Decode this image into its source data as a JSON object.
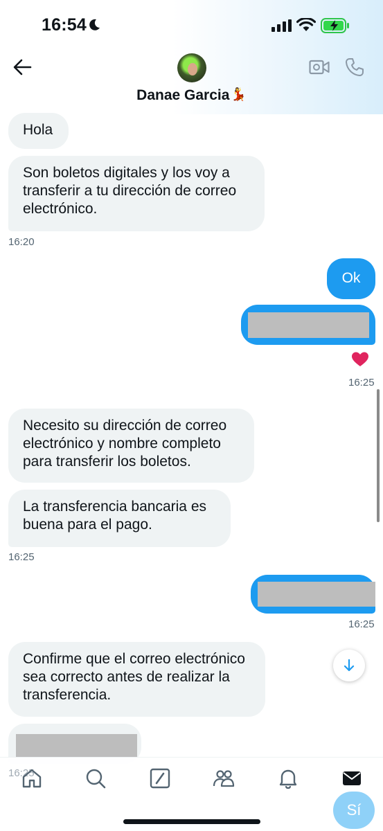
{
  "status_bar": {
    "time": "16:54"
  },
  "header": {
    "contact_name": "Danae Garcia"
  },
  "messages": [
    {
      "text": "Hola"
    },
    {
      "text": "Son boletos digitales y los voy a transferir a tu dirección de correo electrónico."
    },
    {
      "time": "16:20"
    },
    {
      "text": "Ok"
    },
    {
      "time": "16:25"
    },
    {
      "text": "Necesito su dirección de correo electrónico y nombre completo para transferir los boletos."
    },
    {
      "text": "La transferencia bancaria es buena para el pago."
    },
    {
      "time": "16:25"
    },
    {
      "time": "16:25"
    },
    {
      "text": "Confirme que el correo electrónico sea correcto antes de realizar la transferencia."
    },
    {
      "time": "16:25"
    }
  ],
  "fab": {
    "label": "Sí"
  },
  "colors": {
    "accent": "#1d9bf0",
    "incoming_bubble": "#eff3f4",
    "reaction": "#e0245e"
  },
  "icons": [
    "moon-icon",
    "signal-icon",
    "wifi-icon",
    "battery-charging-icon",
    "back-arrow-icon",
    "video-call-icon",
    "phone-icon",
    "heart-icon",
    "arrow-down-icon",
    "home-icon",
    "search-icon",
    "grok-icon",
    "communities-icon",
    "bell-icon",
    "mail-icon"
  ]
}
